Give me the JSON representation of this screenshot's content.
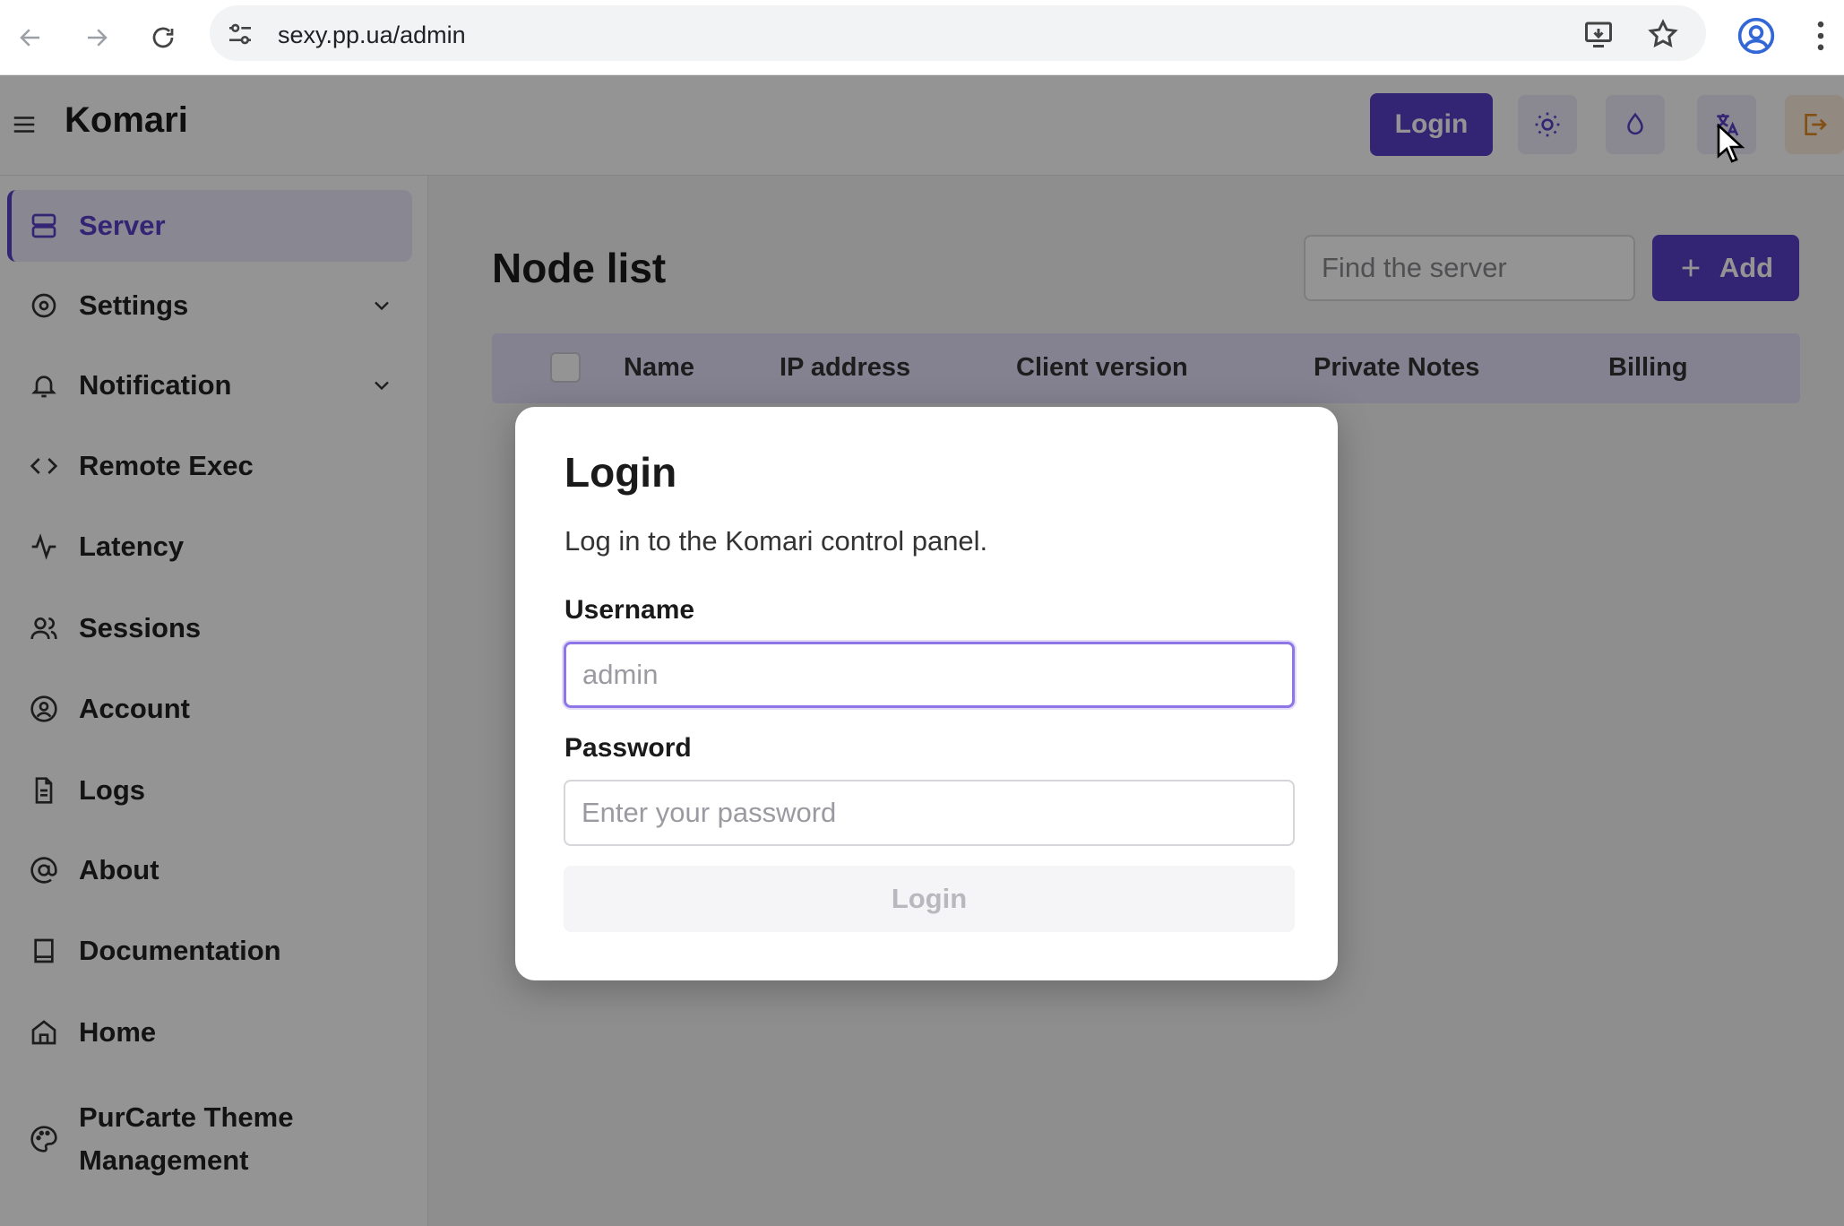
{
  "browser": {
    "url": "sexy.pp.ua/admin",
    "icons": [
      "back-icon",
      "forward-icon",
      "reload-icon",
      "site-settings-icon",
      "install-app-icon",
      "bookmark-star-icon",
      "profile-icon",
      "more-menu-icon"
    ]
  },
  "header": {
    "brand": "Komari",
    "login_label": "Login",
    "icons": [
      "sun-icon",
      "droplet-icon",
      "language-icon",
      "exit-icon"
    ]
  },
  "sidebar": {
    "items": [
      {
        "label": "Server",
        "icon": "server-icon",
        "active": true
      },
      {
        "label": "Settings",
        "icon": "settings-icon",
        "expandable": true
      },
      {
        "label": "Notification",
        "icon": "bell-icon",
        "expandable": true
      },
      {
        "label": "Remote Exec",
        "icon": "code-icon"
      },
      {
        "label": "Latency",
        "icon": "activity-icon"
      },
      {
        "label": "Sessions",
        "icon": "users-icon"
      },
      {
        "label": "Account",
        "icon": "user-circle-icon"
      },
      {
        "label": "Logs",
        "icon": "file-text-icon"
      },
      {
        "label": "About",
        "icon": "at-sign-icon"
      },
      {
        "label": "Documentation",
        "icon": "book-icon"
      },
      {
        "label": "Home",
        "icon": "home-icon"
      },
      {
        "label": "PurCarte Theme Management",
        "line1": "PurCarte Theme",
        "line2": "Management",
        "icon": "palette-icon"
      }
    ]
  },
  "main": {
    "title": "Node list",
    "search_placeholder": "Find the server",
    "add_label": "Add",
    "columns": [
      "Name",
      "IP address",
      "Client version",
      "Private Notes",
      "Billing"
    ]
  },
  "modal": {
    "title": "Login",
    "description": "Log in to the Komari control panel.",
    "username_label": "Username",
    "username_placeholder": "admin",
    "password_label": "Password",
    "password_placeholder": "Enter your password",
    "submit_label": "Login"
  },
  "colors": {
    "accent": "#5b3fc8",
    "accent_light": "#e4defa",
    "exit_orange": "#e08a25"
  }
}
